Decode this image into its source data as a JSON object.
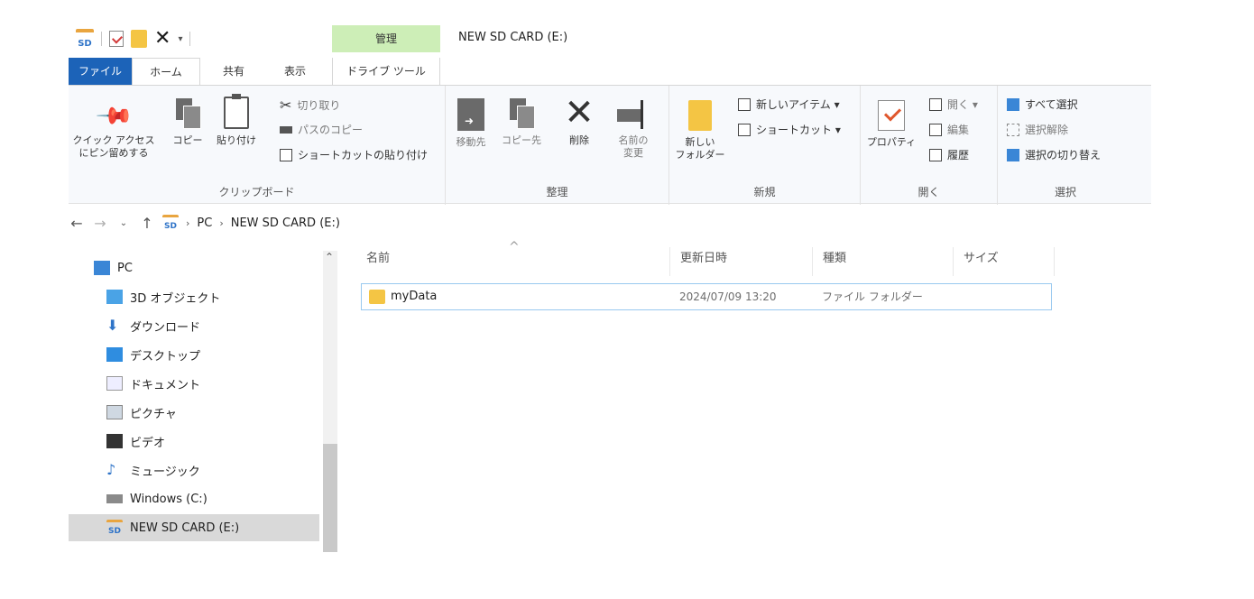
{
  "window": {
    "title": "NEW SD CARD (E:)",
    "manage_tab": "管理"
  },
  "tabs": {
    "file": "ファイル",
    "home": "ホーム",
    "share": "共有",
    "view": "表示",
    "drive_tools": "ドライブ ツール"
  },
  "ribbon": {
    "clipboard": {
      "pin": "クイック アクセス\nにピン留めする",
      "copy": "コピー",
      "paste": "貼り付け",
      "cut": "切り取り",
      "copy_path": "パスのコピー",
      "paste_shortcut": "ショートカットの貼り付け",
      "label": "クリップボード"
    },
    "organize": {
      "move_to": "移動先",
      "copy_to": "コピー先",
      "delete": "削除",
      "rename": "名前の\n変更",
      "label": "整理"
    },
    "new": {
      "new_folder": "新しい\nフォルダー",
      "new_item": "新しいアイテム ▾",
      "shortcut": "ショートカット ▾",
      "label": "新規"
    },
    "open": {
      "properties": "プロパティ",
      "open": "開く ▾",
      "edit": "編集",
      "history": "履歴",
      "label": "開く"
    },
    "select": {
      "select_all": "すべて選択",
      "select_none": "選択解除",
      "invert": "選択の切り替え",
      "label": "選択"
    }
  },
  "address": {
    "crumbs": [
      "PC",
      "NEW SD CARD (E:)"
    ]
  },
  "navpane": {
    "items": [
      {
        "label": "PC",
        "icon": "pc-icon"
      },
      {
        "label": "3D オブジェクト",
        "icon": "3d-objects-icon"
      },
      {
        "label": "ダウンロード",
        "icon": "download-icon"
      },
      {
        "label": "デスクトップ",
        "icon": "desktop-icon"
      },
      {
        "label": "ドキュメント",
        "icon": "documents-icon"
      },
      {
        "label": "ピクチャ",
        "icon": "pictures-icon"
      },
      {
        "label": "ビデオ",
        "icon": "videos-icon"
      },
      {
        "label": "ミュージック",
        "icon": "music-icon"
      },
      {
        "label": "Windows (C:)",
        "icon": "drive-icon"
      },
      {
        "label": "NEW SD CARD (E:)",
        "icon": "sdcard-icon"
      }
    ]
  },
  "filelist": {
    "headers": {
      "name": "名前",
      "modified": "更新日時",
      "type": "種類",
      "size": "サイズ"
    },
    "rows": [
      {
        "name": "myData",
        "modified": "2024/07/09 13:20",
        "type": "ファイル フォルダー",
        "size": ""
      }
    ]
  },
  "colors": {
    "file_tab": "#1c63b8",
    "manage_tab": "#cdeeb7",
    "folder": "#f4c544",
    "selection_border": "#99c9ef"
  }
}
